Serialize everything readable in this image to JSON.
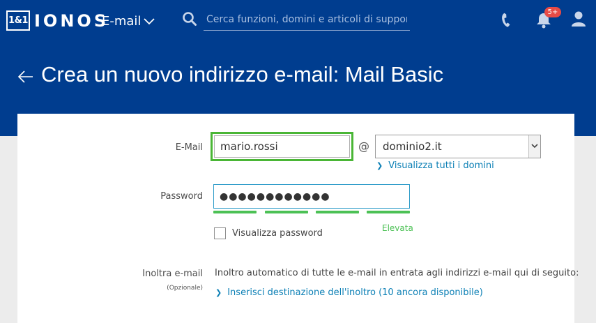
{
  "header": {
    "logo_box": "1&1",
    "logo_text": "IONOS",
    "app_switcher_label": "E-mail",
    "search_placeholder": "Cerca funzioni, domini e articoli di supporto",
    "notification_badge": "5+"
  },
  "page": {
    "title": "Crea un nuovo indirizzo e-mail: Mail Basic"
  },
  "form": {
    "email_label": "E-Mail",
    "email_value": "mario.rossi",
    "at_sign": "@",
    "domain_value": "dominio2.it",
    "show_domains_link": "Visualizza tutti i domini",
    "password_label": "Password",
    "password_value": "●●●●●●●●●●●●",
    "password_strength": "Elevata",
    "password_strength_segments_filled": 4,
    "show_password_label": "Visualizza password",
    "forward_label": "Inoltra e-mail",
    "forward_optional": "(Opzionale)",
    "forward_description": "Inoltro automatico di tutte le e-mail in entrata agli indirizzi e-mail qui di seguito:",
    "forward_link": "Inserisci destinazione dell'inoltro (10 ancora disponibile)"
  },
  "colors": {
    "brand_blue": "#003d8f",
    "focus_green": "#4ab636",
    "strength_green": "#4cc155",
    "link_blue": "#0b7fb5",
    "badge_red": "#e84b46"
  },
  "icons": [
    "search-icon",
    "phone-icon",
    "bell-icon",
    "user-icon",
    "back-arrow-icon",
    "chevron-down-icon",
    "chevron-right-icon"
  ]
}
